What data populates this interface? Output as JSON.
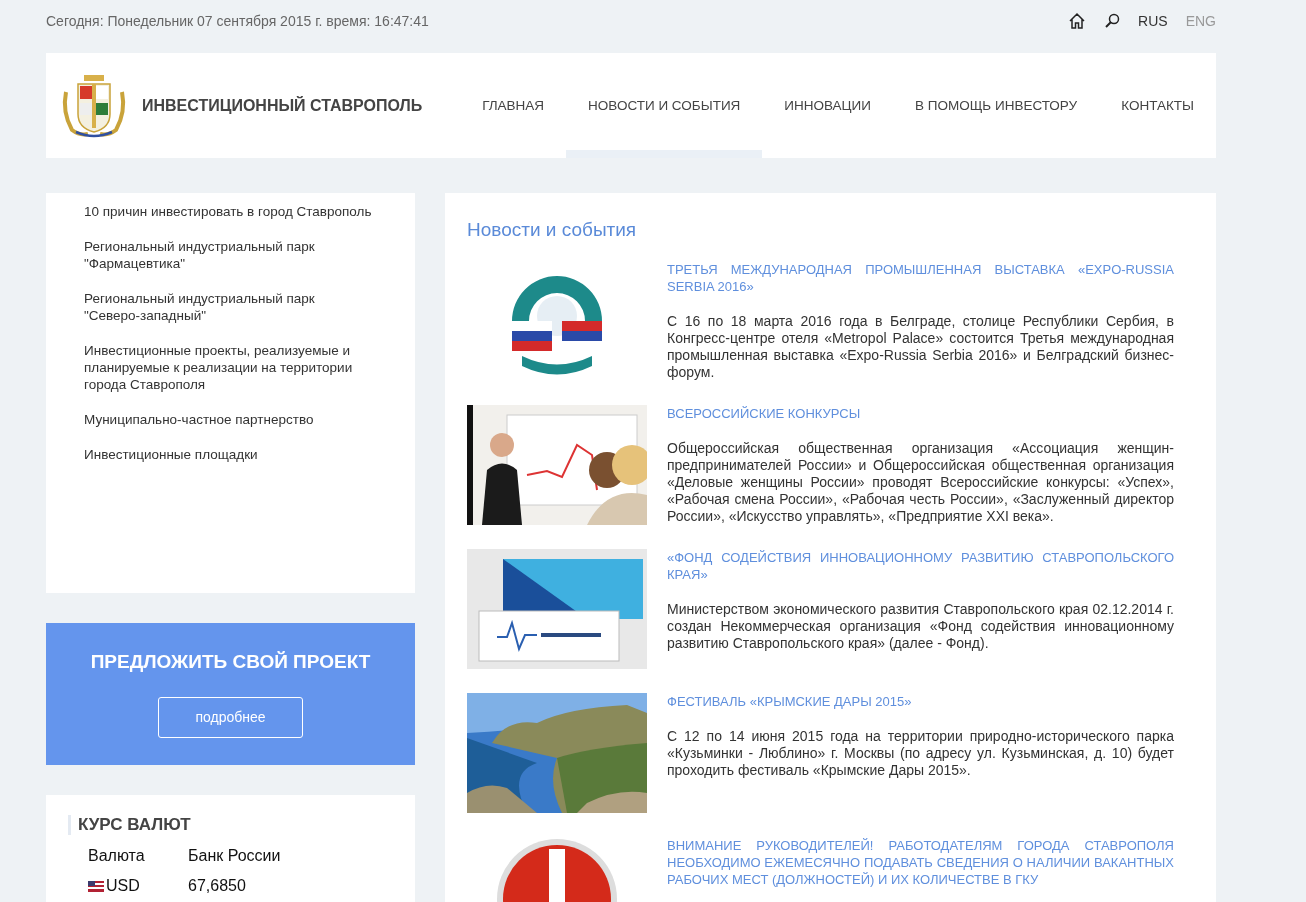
{
  "top_bar": {
    "date_text": "Сегодня: Понедельник 07 сентября 2015 г. время: 16:47:41",
    "languages": [
      {
        "label": "RUS",
        "selected": true
      },
      {
        "label": "ENG",
        "selected": false
      }
    ]
  },
  "header": {
    "site_title": "ИНВЕСТИЦИОННЫЙ СТАВРОПОЛЬ",
    "nav": [
      {
        "label": "ГЛАВНАЯ",
        "selected": false
      },
      {
        "label": "НОВОСТИ И СОБЫТИЯ",
        "selected": true
      },
      {
        "label": "ИННОВАЦИИ",
        "selected": false
      },
      {
        "label": "В ПОМОЩЬ ИНВЕСТОРУ",
        "selected": false
      },
      {
        "label": "КОНТАКТЫ",
        "selected": false
      }
    ]
  },
  "sidebar": {
    "items": [
      "10 причин инвестировать в город Ставрополь",
      "Региональный индустриальный парк \"Фармацевтика\"",
      "Региональный индустриальный парк \"Северо-западный\"",
      "Инвестиционные проекты, реализуемые и планируемые к реализации на территории города Ставрополя",
      "Муниципально-частное партнерство",
      "Инвестиционные площадки"
    ]
  },
  "promo": {
    "title": "ПРЕДЛОЖИТЬ СВОЙ ПРОЕКТ",
    "button": "подробнее"
  },
  "currency": {
    "title": "КУРС ВАЛЮТ",
    "columns": [
      "Валюта",
      "Банк России"
    ],
    "rows": [
      {
        "code": "USD",
        "rate": "67,6850"
      }
    ]
  },
  "news": {
    "title": "Новости и события",
    "items": [
      {
        "title": "ТРЕТЬЯ МЕЖДУНАРОДНАЯ ПРОМЫШЛЕННАЯ ВЫСТАВКА «EXPO-RUSSIA SERBIA 2016»",
        "text": "С 16 по 18 марта 2016 года в Белграде, столице Республики Сербия, в Конгресс-центре отеля «Metropol Palace» состоится Третья международная промышленная выставка «Expo-Russia Serbia 2016» и Белградский бизнес-форум."
      },
      {
        "title": "ВСЕРОССИЙСКИЕ КОНКУРСЫ",
        "text": "Общероссийская общественная организация «Ассоциация женщин-предпринимателей России» и Общероссийская общественная организация «Деловые женщины России» проводят Всероссийские конкурсы: «Успех», «Рабочая смена России», «Рабочая честь России», «Заслуженный директор России», «Искусство управлять», «Предприятие XXI века»."
      },
      {
        "title": "«ФОНД СОДЕЙСТВИЯ ИННОВАЦИОННОМУ РАЗВИТИЮ СТАВРОПОЛЬСКОГО КРАЯ»",
        "text": "Министерством экономического развития Ставропольского края 02.12.2014 г. создан Некоммерческая организация «Фонд содействия инновационному развитию Ставропольского края» (далее - Фонд)."
      },
      {
        "title": "ФЕСТИВАЛЬ «КРЫМСКИЕ ДАРЫ 2015»",
        "text": "С 12 по 14 июня 2015 года на территории природно-исторического парка «Кузьминки - Люблино» г. Москвы (по адресу ул. Кузьминская, д. 10) будет проходить фестиваль «Крымские Дары 2015»."
      },
      {
        "title": "ВНИМАНИЕ РУКОВОДИТЕЛЕЙ! РАБОТОДАТЕЛЯМ ГОРОДА СТАВРОПОЛЯ НЕОБХОДИМО ЕЖЕМЕСЯЧНО ПОДАВАТЬ СВЕДЕНИЯ О НАЛИЧИИ ВАКАНТНЫХ РАБОЧИХ МЕСТ (ДОЛЖНОСТЕЙ) И ИХ КОЛИЧЕСТВЕ В ГКУ"
      }
    ]
  }
}
